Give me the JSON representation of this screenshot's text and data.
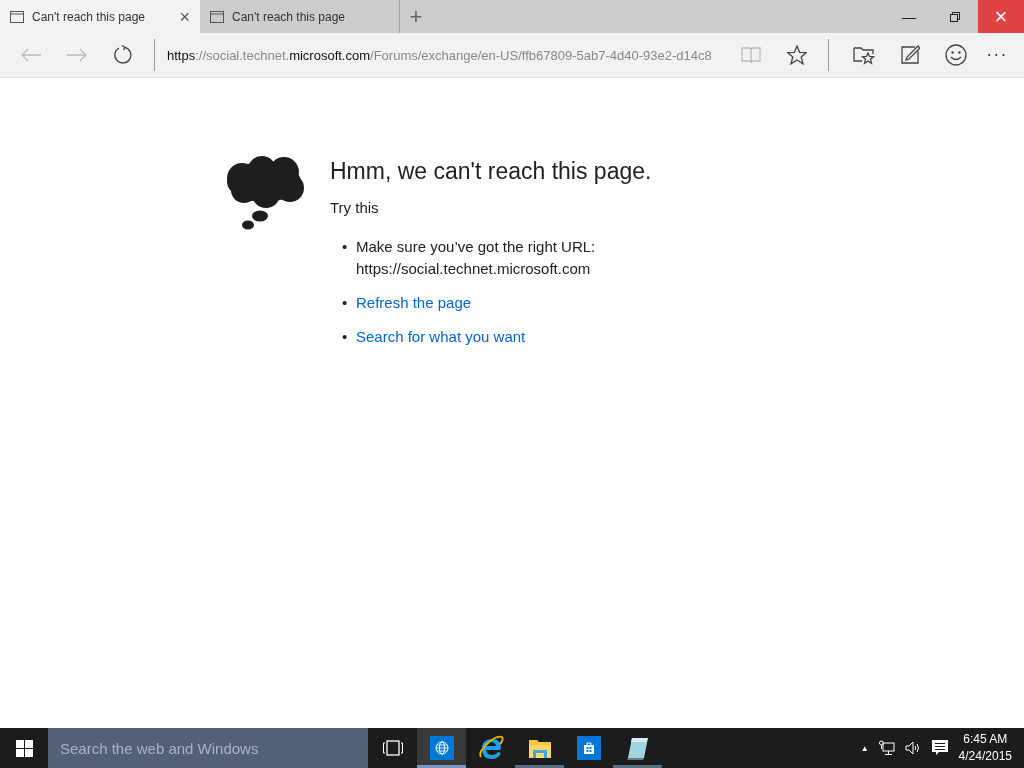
{
  "tabs": [
    {
      "title": "Can't reach this page",
      "selected": true,
      "close": "×"
    },
    {
      "title": "Can't reach this page",
      "selected": false
    }
  ],
  "new_tab": "+",
  "window_controls": {
    "minimize": "—",
    "close": "×"
  },
  "address_bar": {
    "segments": [
      {
        "text": "https",
        "highlighted": true
      },
      {
        "text": "://social.technet.",
        "highlighted": false
      },
      {
        "text": "microsoft.com",
        "highlighted": true
      },
      {
        "text": "/Forums/exchange/en-US/ffb67809-5ab7-4d40-93e2-d14c8",
        "highlighted": false
      }
    ],
    "reading_view_disabled": true
  },
  "more_button": "···",
  "error": {
    "heading": "Hmm, we can't reach this page.",
    "subheading": "Try this",
    "items": [
      {
        "kind": "text",
        "bullet": "•",
        "text": "Make sure you’ve got the right URL:\nhttps://social.technet.microsoft.com"
      },
      {
        "kind": "link",
        "bullet": "•",
        "text": "Refresh the page"
      },
      {
        "kind": "link",
        "bullet": "•",
        "text": "Search for what you want"
      }
    ]
  },
  "taskbar": {
    "search_placeholder": "Search the web and Windows",
    "apps": [
      {
        "kind": "task-view",
        "running": false,
        "active": false
      },
      {
        "kind": "browser",
        "running": true,
        "active": true
      },
      {
        "kind": "ie",
        "running": false,
        "active": false
      },
      {
        "kind": "explorer",
        "running": true,
        "active": false
      },
      {
        "kind": "store",
        "running": false,
        "active": false
      },
      {
        "kind": "notepad",
        "running": true,
        "active": false
      }
    ],
    "tray_arrow": "▲",
    "time": "6:45 AM",
    "date": "4/24/2015"
  }
}
